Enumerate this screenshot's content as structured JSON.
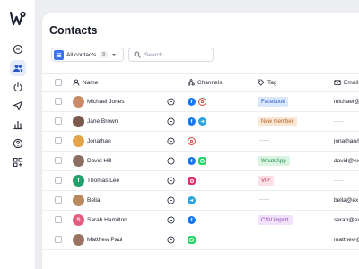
{
  "page": {
    "title": "Contacts"
  },
  "sidebar": {
    "items": [
      {
        "icon": "chat-icon",
        "active": false
      },
      {
        "icon": "users-icon",
        "active": true
      },
      {
        "icon": "power-icon",
        "active": false
      },
      {
        "icon": "send-icon",
        "active": false
      },
      {
        "icon": "bar-chart-icon",
        "active": false
      },
      {
        "icon": "help-icon",
        "active": false
      },
      {
        "icon": "apps-icon",
        "active": false
      }
    ]
  },
  "toolbar": {
    "contacts_label": "All contacts",
    "contacts_count": "8",
    "search_placeholder": "Search"
  },
  "table": {
    "columns": {
      "name": "Name",
      "channels": "Channels",
      "tag": "Tag",
      "email": "Email"
    },
    "rows": [
      {
        "name": "Michael Jones",
        "initial": "",
        "avatar_color": "#c98b67",
        "channels": [
          "facebook",
          "email"
        ],
        "tag": "Facebook",
        "tag_bg": "#dbe7fd",
        "tag_fg": "#2b5bc8",
        "email": "michael@..."
      },
      {
        "name": "Jane Brown",
        "initial": "",
        "avatar_color": "#7b5a4c",
        "channels": [
          "facebook",
          "telegram"
        ],
        "tag": "New member",
        "tag_bg": "#fbe6d3",
        "tag_fg": "#b0612a",
        "email": "-----"
      },
      {
        "name": "Jonathan",
        "initial": "",
        "avatar_color": "#e3a44a",
        "channels": [
          "email"
        ],
        "tag": "-----",
        "tag_bg": "",
        "tag_fg": "",
        "email": "jonathan@..."
      },
      {
        "name": "David Hill",
        "initial": "",
        "avatar_color": "#8c6f63",
        "channels": [
          "facebook",
          "whatsapp"
        ],
        "tag": "WhatsApp",
        "tag_bg": "#d9f5e1",
        "tag_fg": "#1f8a45",
        "email": "david@ex..."
      },
      {
        "name": "Thomas Lee",
        "initial": "T",
        "avatar_color": "#22a06b",
        "channels": [
          "instagram"
        ],
        "tag": "VIP",
        "tag_bg": "#fde0e6",
        "tag_fg": "#c8284d",
        "email": "-----"
      },
      {
        "name": "Bella",
        "initial": "",
        "avatar_color": "#b98a5f",
        "channels": [
          "telegram"
        ],
        "tag": "-----",
        "tag_bg": "",
        "tag_fg": "",
        "email": "bella@ex..."
      },
      {
        "name": "Sarah Hamilton",
        "initial": "S",
        "avatar_color": "#e35d7e",
        "channels": [
          "facebook"
        ],
        "tag": "CSV import",
        "tag_bg": "#f1e1fb",
        "tag_fg": "#8a3fb5",
        "email": "sarah@ex..."
      },
      {
        "name": "Matthew Paul",
        "initial": "",
        "avatar_color": "#9b7361",
        "channels": [
          "whatsapp"
        ],
        "tag": "-----",
        "tag_bg": "",
        "tag_fg": "",
        "email": "matthew@..."
      }
    ]
  },
  "colors": {
    "accent": "#3b72ee"
  }
}
